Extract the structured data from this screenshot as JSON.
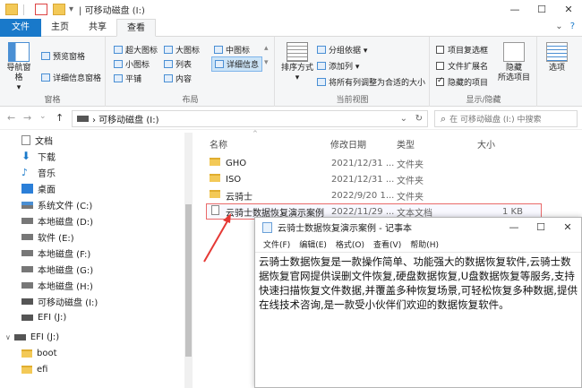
{
  "window": {
    "title": "| 可移动磁盘 (I:)",
    "minimize": "—",
    "maximize": "☐",
    "close": "✕"
  },
  "tabs": [
    {
      "label": "文件"
    },
    {
      "label": "主页"
    },
    {
      "label": "共享"
    },
    {
      "label": "查看"
    }
  ],
  "tabs_right": {
    "expand": "⌄",
    "help": "?"
  },
  "ribbon": {
    "pane": {
      "nav_pane": "导航窗格",
      "preview_pane": "预览窗格",
      "details_pane": "详细信息窗格",
      "label": "窗格"
    },
    "layout": {
      "xl_icons": "超大图标",
      "large_icons": "大图标",
      "medium_icons": "中图标",
      "small_icons": "小图标",
      "list": "列表",
      "details": "详细信息",
      "tiles": "平铺",
      "content": "内容",
      "label": "布局"
    },
    "current_view": {
      "sort_by": "排序方式",
      "group_by": "分组依据 ▾",
      "add_columns": "添加列 ▾",
      "fit_columns": "将所有列调整为合适的大小",
      "label": "当前视图"
    },
    "show_hide": {
      "item_checkboxes": "项目复选框",
      "file_extensions": "文件扩展名",
      "hidden_items": "隐藏的项目",
      "hide_selected": "隐藏",
      "hide_selected_2": "所选项目",
      "options": "选项",
      "label": "显示/隐藏"
    }
  },
  "address": {
    "back": "←",
    "forward": "→",
    "recent": "⌄",
    "up": "↑",
    "path": "› 可移动磁盘 (I:)",
    "path_dropdown": "⌄",
    "refresh": "↻",
    "search_placeholder": "在 可移动磁盘 (I:) 中搜索",
    "search_icon": "⌕"
  },
  "sidebar": {
    "items": [
      {
        "label": "文档"
      },
      {
        "label": "下载"
      },
      {
        "label": "音乐"
      },
      {
        "label": "桌面"
      },
      {
        "label": "系统文件 (C:)"
      },
      {
        "label": "本地磁盘 (D:)"
      },
      {
        "label": "软件 (E:)"
      },
      {
        "label": "本地磁盘 (F:)"
      },
      {
        "label": "本地磁盘 (G:)"
      },
      {
        "label": "本地磁盘 (H:)"
      },
      {
        "label": "可移动磁盘 (I:)"
      },
      {
        "label": "EFI (J:)"
      }
    ],
    "efi_section": "EFI (J:)",
    "efi_children": [
      {
        "label": "boot"
      },
      {
        "label": "efi"
      }
    ],
    "collapse_arrow": "∨"
  },
  "columns": {
    "name": "名称",
    "modified": "修改日期",
    "type": "类型",
    "size": "大小"
  },
  "files": [
    {
      "name": "GHO",
      "modified": "2021/12/31 ...",
      "type": "文件夹",
      "size": ""
    },
    {
      "name": "ISO",
      "modified": "2021/12/31 ...",
      "type": "文件夹",
      "size": ""
    },
    {
      "name": "云骑士",
      "modified": "2022/9/20 1...",
      "type": "文件夹",
      "size": ""
    },
    {
      "name": "云骑士数据恢复演示案例",
      "modified": "2022/11/29 ...",
      "type": "文本文档",
      "size": "1 KB"
    }
  ],
  "notepad": {
    "title": "云骑士数据恢复演示案例 - 记事本",
    "minimize": "—",
    "maximize": "☐",
    "close": "✕",
    "menu": [
      "文件(F)",
      "编辑(E)",
      "格式(O)",
      "查看(V)",
      "帮助(H)"
    ],
    "content": "云骑士数据恢复是一款操作简单、功能强大的数据恢复软件,云骑士数据恢复官网提供误删文件恢复,硬盘数据恢复,U盘数据恢复等服务,支持快速扫描恢复文件数据,并覆盖多种恢复场景,可轻松恢复多种数据,提供在线技术咨询,是一款受小伙伴们欢迎的数据恢复软件。"
  },
  "colors": {
    "file_tab": "#1979ca",
    "highlight_border": "#ea6a6a",
    "arrow": "#e53935",
    "folder": "#f3c957"
  }
}
